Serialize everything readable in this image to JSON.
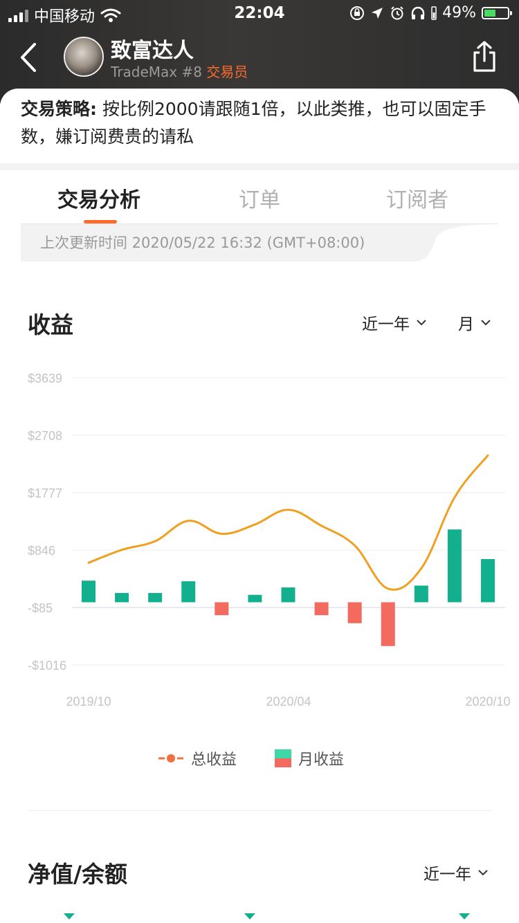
{
  "status_bar": {
    "carrier": "中国移动",
    "time": "22:04",
    "battery": "49%"
  },
  "header": {
    "name": "致富达人",
    "platform": "TradeMax",
    "rank": "#8",
    "role": "交易员",
    "colors": {
      "role": "#ff6a2b"
    }
  },
  "strategy": {
    "label": "交易策略:",
    "text": "按比例2000请跟随1倍，以此类推，也可以固定手数，嫌订阅费贵的请私"
  },
  "tabs": [
    {
      "label": "交易分析",
      "active": true
    },
    {
      "label": "订单",
      "active": false
    },
    {
      "label": "订阅者",
      "active": false
    }
  ],
  "update": {
    "text": "上次更新时间 2020/05/22 16:32 (GMT+08:00)"
  },
  "profit_section": {
    "title": "收益",
    "range_filter": "近一年",
    "period_filter": "月"
  },
  "chart_data": {
    "type": "bar",
    "title": "",
    "ylim": [
      -1016,
      3639
    ],
    "y_ticks": [
      "$3639",
      "$2708",
      "$1777",
      "$846",
      "-$85",
      "-$1016"
    ],
    "x_ticks": [
      "2019/10",
      "2020/04",
      "2020/10"
    ],
    "grid": true,
    "legend_position": "bottom",
    "series": [
      {
        "name": "月收益",
        "type": "bar",
        "colors": {
          "positive": "#12b08f",
          "negative": "#f26b5e"
        },
        "values": [
          350,
          150,
          150,
          340,
          -210,
          120,
          240,
          -210,
          -340,
          -710,
          270,
          1180,
          700
        ]
      },
      {
        "name": "总收益",
        "type": "line",
        "color": "#f0a020",
        "values": [
          640,
          850,
          990,
          1320,
          1110,
          1260,
          1500,
          1240,
          920,
          220,
          550,
          1700,
          2380
        ]
      }
    ]
  },
  "legend": [
    {
      "label": "总收益",
      "color": "#f07040"
    },
    {
      "label": "月收益",
      "colors": [
        "#3dd8a8",
        "#f26b5e"
      ]
    }
  ],
  "net_section": {
    "title": "净值/余额",
    "range_filter": "近一年"
  }
}
